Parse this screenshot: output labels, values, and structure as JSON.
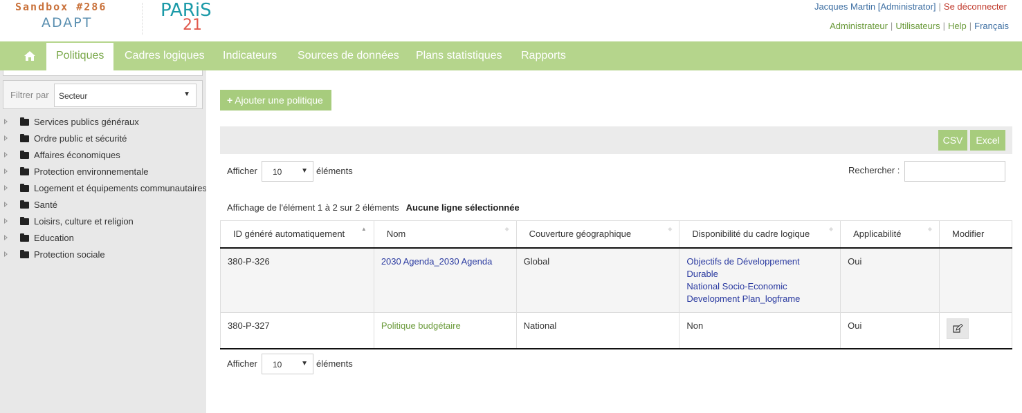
{
  "header": {
    "sandbox": "Sandbox #286",
    "adapt": "ADAPT",
    "paris": "PARiS",
    "paris_21": "21",
    "user": "Jacques Martin [Administrator]",
    "sep": "|",
    "logout": "Se déconnecter",
    "links": [
      "Administrateur",
      "Utilisateurs",
      "Help"
    ],
    "language": "Français"
  },
  "nav": {
    "home_icon": "home-icon",
    "items": [
      "Politiques",
      "Cadres logiques",
      "Indicateurs",
      "Sources de données",
      "Plans statistiques",
      "Rapports"
    ],
    "active": "Politiques"
  },
  "sidebar": {
    "filter_label": "Filtrer par",
    "filter_value": "Secteur",
    "tree": [
      "Services publics généraux",
      "Ordre public et sécurité",
      "Affaires économiques",
      "Protection environnementale",
      "Logement et équipements communautaires",
      "Santé",
      "Loisirs, culture et religion",
      "Education",
      "Protection sociale"
    ]
  },
  "main": {
    "add_button": "Ajouter une politique",
    "add_icon": "+",
    "csv": "CSV",
    "excel": "Excel",
    "show_label": "Afficher",
    "show_value": "10",
    "elements_label": "éléments",
    "search_label": "Rechercher :",
    "info": "Affichage de l'élément 1 à 2 sur 2 éléments",
    "selection": "Aucune ligne sélectionnée",
    "columns": [
      "ID généré automatiquement",
      "Nom",
      "Couverture géographique",
      "Disponibilité du cadre logique",
      "Applicabilité",
      "Modifier"
    ],
    "rows": [
      {
        "id": "380-P-326",
        "name": "2030 Agenda_2030 Agenda",
        "coverage": "Global",
        "framework": [
          "Objectifs de Développement Durable",
          "National Socio-Economic Development Plan_logframe"
        ],
        "applicability": "Oui"
      },
      {
        "id": "380-P-327",
        "name": "Politique budgétaire",
        "coverage": "National",
        "framework_text": "Non",
        "applicability": "Oui"
      }
    ]
  }
}
